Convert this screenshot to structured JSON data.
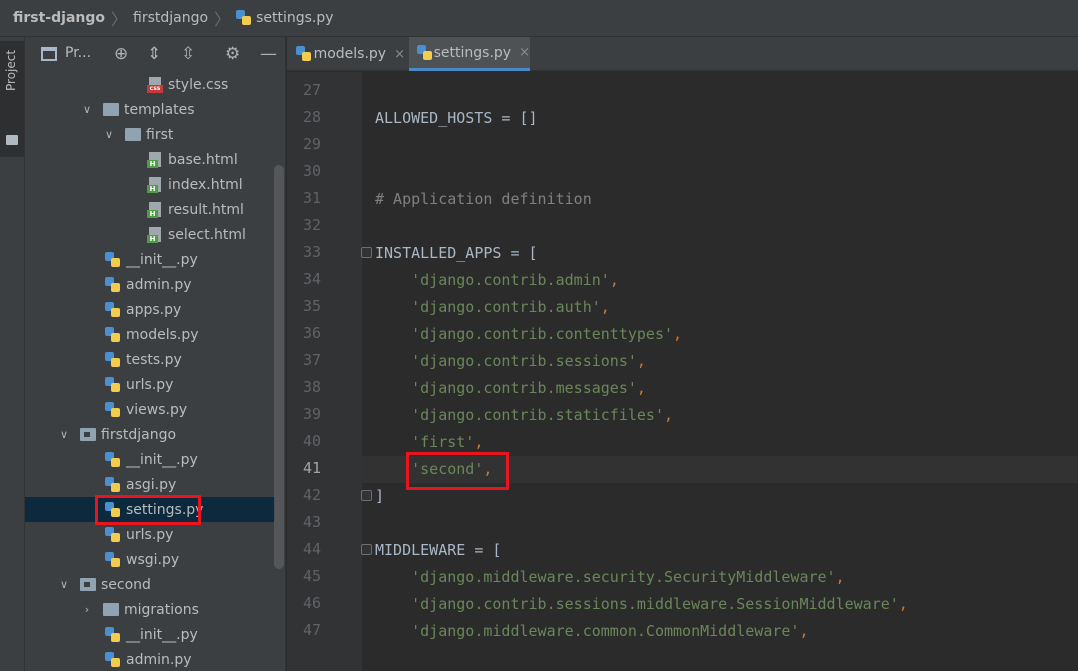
{
  "breadcrumb": [
    "first-django",
    "firstdjango",
    "settings.py"
  ],
  "strip": {
    "label": "Project"
  },
  "panel": {
    "title": "Pr..."
  },
  "tree": [
    {
      "label": "style.css",
      "icon": "css-file-icon"
    },
    {
      "label": "templates",
      "icon": "folder-icon"
    },
    {
      "label": "first",
      "icon": "folder-icon"
    },
    {
      "label": "base.html",
      "icon": "html-file-icon"
    },
    {
      "label": "index.html",
      "icon": "html-file-icon"
    },
    {
      "label": "result.html",
      "icon": "html-file-icon"
    },
    {
      "label": "select.html",
      "icon": "html-file-icon"
    },
    {
      "label": "__init__.py",
      "icon": "python-file-icon"
    },
    {
      "label": "admin.py",
      "icon": "python-file-icon"
    },
    {
      "label": "apps.py",
      "icon": "python-file-icon"
    },
    {
      "label": "models.py",
      "icon": "python-file-icon"
    },
    {
      "label": "tests.py",
      "icon": "python-file-icon"
    },
    {
      "label": "urls.py",
      "icon": "python-file-icon"
    },
    {
      "label": "views.py",
      "icon": "python-file-icon"
    },
    {
      "label": "firstdjango",
      "icon": "package-folder-icon"
    },
    {
      "label": "__init__.py",
      "icon": "python-file-icon"
    },
    {
      "label": "asgi.py",
      "icon": "python-file-icon"
    },
    {
      "label": "settings.py",
      "icon": "python-file-icon",
      "selected": true
    },
    {
      "label": "urls.py",
      "icon": "python-file-icon"
    },
    {
      "label": "wsgi.py",
      "icon": "python-file-icon"
    },
    {
      "label": "second",
      "icon": "package-folder-icon"
    },
    {
      "label": "migrations",
      "icon": "folder-icon"
    },
    {
      "label": "__init__.py",
      "icon": "python-file-icon"
    },
    {
      "label": "admin.py",
      "icon": "python-file-icon"
    }
  ],
  "tabs": [
    {
      "label": "models.py",
      "close": "×"
    },
    {
      "label": "settings.py",
      "close": "×",
      "active": true
    }
  ],
  "editor": {
    "current_line": 41,
    "lines": [
      {
        "n": "27",
        "code": ""
      },
      {
        "n": "28",
        "code": "ALLOWED_HOSTS = []"
      },
      {
        "n": "29",
        "code": ""
      },
      {
        "n": "30",
        "code": ""
      },
      {
        "n": "31",
        "code": "# Application definition"
      },
      {
        "n": "32",
        "code": ""
      },
      {
        "n": "33",
        "code": "INSTALLED_APPS = ["
      },
      {
        "n": "34",
        "code": "    'django.contrib.admin',"
      },
      {
        "n": "35",
        "code": "    'django.contrib.auth',"
      },
      {
        "n": "36",
        "code": "    'django.contrib.contenttypes',"
      },
      {
        "n": "37",
        "code": "    'django.contrib.sessions',"
      },
      {
        "n": "38",
        "code": "    'django.contrib.messages',"
      },
      {
        "n": "39",
        "code": "    'django.contrib.staticfiles',"
      },
      {
        "n": "40",
        "code": "    'first',"
      },
      {
        "n": "41",
        "code": "    'second',"
      },
      {
        "n": "42",
        "code": "]"
      },
      {
        "n": "43",
        "code": ""
      },
      {
        "n": "44",
        "code": "MIDDLEWARE = ["
      },
      {
        "n": "45",
        "code": "    'django.middleware.security.SecurityMiddleware',"
      },
      {
        "n": "46",
        "code": "    'django.contrib.sessions.middleware.SessionMiddleware',"
      },
      {
        "n": "47",
        "code": "    'django.middleware.common.CommonMiddleware',"
      }
    ]
  },
  "colors": {
    "string": "#6a8759",
    "comment": "#808080",
    "highlight_box": "#e8141e",
    "selection": "#0d293e"
  }
}
